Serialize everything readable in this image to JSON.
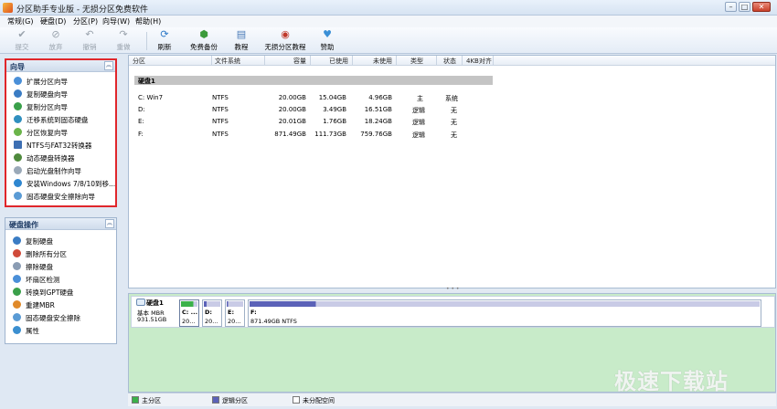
{
  "window": {
    "title": "分区助手专业版 - 无损分区免费软件",
    "min": "–",
    "max": "□",
    "close": "✕"
  },
  "menu": [
    "常规(G)",
    "硬盘(D)",
    "分区(P)",
    "向导(W)",
    "帮助(H)"
  ],
  "toolbar": {
    "commit": "提交",
    "discard": "放弃",
    "undo": "撤销",
    "redo": "重做",
    "refresh": "刷新",
    "free_backup": "免费备份",
    "tutorial": "教程",
    "lossless_tutorial": "无损分区教程",
    "donate": "赞助"
  },
  "wizard_panel": {
    "title": "向导",
    "items": [
      "扩展分区向导",
      "复制硬盘向导",
      "复制分区向导",
      "迁移系统到固态硬盘",
      "分区恢复向导",
      "NTFS与FAT32转换器",
      "动态硬盘转换器",
      "启动光盘制作向导",
      "安装Windows 7/8/10到移...",
      "固态硬盘安全擦除向导"
    ]
  },
  "disk_panel": {
    "title": "硬盘操作",
    "items": [
      "复制硬盘",
      "删除所有分区",
      "擦除硬盘",
      "坏扇区检测",
      "转换到GPT硬盘",
      "重建MBR",
      "固态硬盘安全擦除",
      "属性"
    ]
  },
  "table": {
    "headers": [
      "分区",
      "文件系统",
      "容量",
      "已使用",
      "未使用",
      "类型",
      "状态",
      "4KB对齐"
    ],
    "disk_group": "硬盘1",
    "rows": [
      {
        "name": "C: Win7",
        "fs": "NTFS",
        "capacity": "20.00GB",
        "used": "15.04GB",
        "free": "4.96GB",
        "type": "主",
        "status": "系统"
      },
      {
        "name": "D:",
        "fs": "NTFS",
        "capacity": "20.00GB",
        "used": "3.49GB",
        "free": "16.51GB",
        "type": "逻辑",
        "status": "无"
      },
      {
        "name": "E:",
        "fs": "NTFS",
        "capacity": "20.01GB",
        "used": "1.76GB",
        "free": "18.24GB",
        "type": "逻辑",
        "status": "无"
      },
      {
        "name": "F:",
        "fs": "NTFS",
        "capacity": "871.49GB",
        "used": "111.73GB",
        "free": "759.76GB",
        "type": "逻辑",
        "status": "无"
      }
    ]
  },
  "diskmap": {
    "name": "硬盘1",
    "type": "基本 MBR",
    "size": "931.51GB",
    "parts": [
      {
        "label": "C: ...",
        "size": "20...",
        "color": "#3bb14a",
        "used_fraction": 0.75
      },
      {
        "label": "D:",
        "size": "20...",
        "color": "#5b62b8",
        "used_fraction": 0.17
      },
      {
        "label": "E:",
        "size": "20...",
        "color": "#5b62b8",
        "used_fraction": 0.09
      },
      {
        "label": "F:",
        "size": "871.49GB NTFS",
        "color": "#5b62b8",
        "used_fraction": 0.13
      }
    ]
  },
  "legend": {
    "primary": "主分区",
    "logical": "逻辑分区",
    "unallocated": "未分配空间"
  },
  "watermark": "极速下载站",
  "colors": {
    "primary": "#3bb14a",
    "logical": "#5b62b8",
    "highlight": "#e0262b"
  }
}
